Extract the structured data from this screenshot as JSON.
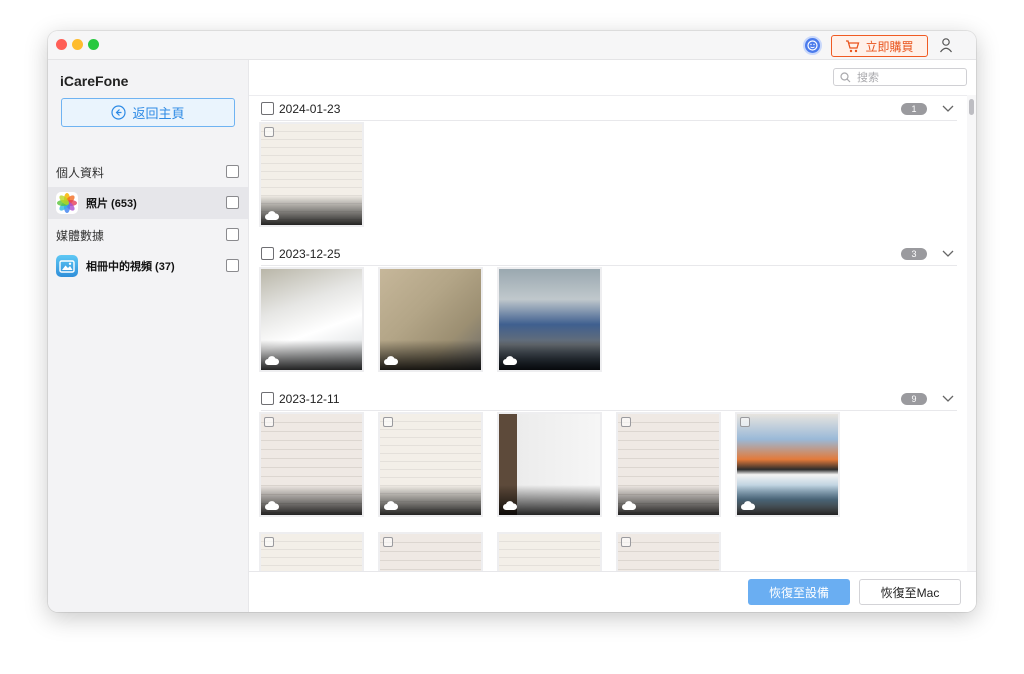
{
  "header": {
    "buy_label": "立即購買"
  },
  "sidebar": {
    "app_name": "iCareFone",
    "back_label": "返回主頁",
    "sections": [
      {
        "label": "個人資料",
        "item_label": "照片 (653)"
      },
      {
        "label": "媒體數據",
        "item_label": "相冊中的視頻 (37)"
      }
    ]
  },
  "search": {
    "placeholder": "搜索"
  },
  "groups": [
    {
      "date": "2024-01-23",
      "count": "1"
    },
    {
      "date": "2023-12-25",
      "count": "3"
    },
    {
      "date": "2023-12-11",
      "count": "9"
    }
  ],
  "actions": {
    "restore_device": "恢復至設備",
    "restore_mac": "恢復至Mac"
  },
  "colors": {
    "accent": "#2d8ae5",
    "buy": "#e9531c",
    "primary_button": "#6aaef2"
  }
}
